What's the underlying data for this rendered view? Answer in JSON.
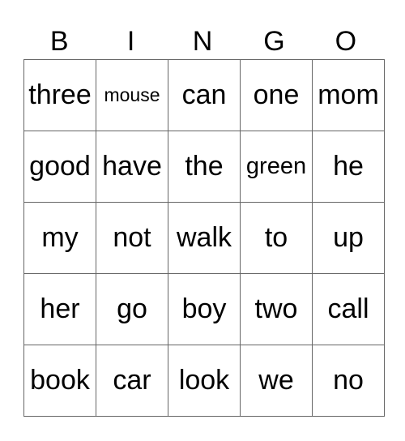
{
  "header": [
    "B",
    "I",
    "N",
    "G",
    "O"
  ],
  "rows": [
    [
      "three",
      "mouse",
      "can",
      "one",
      "mom"
    ],
    [
      "good",
      "have",
      "the",
      "green",
      "he"
    ],
    [
      "my",
      "not",
      "walk",
      "to",
      "up"
    ],
    [
      "her",
      "go",
      "boy",
      "two",
      "call"
    ],
    [
      "book",
      "car",
      "look",
      "we",
      "no"
    ]
  ]
}
